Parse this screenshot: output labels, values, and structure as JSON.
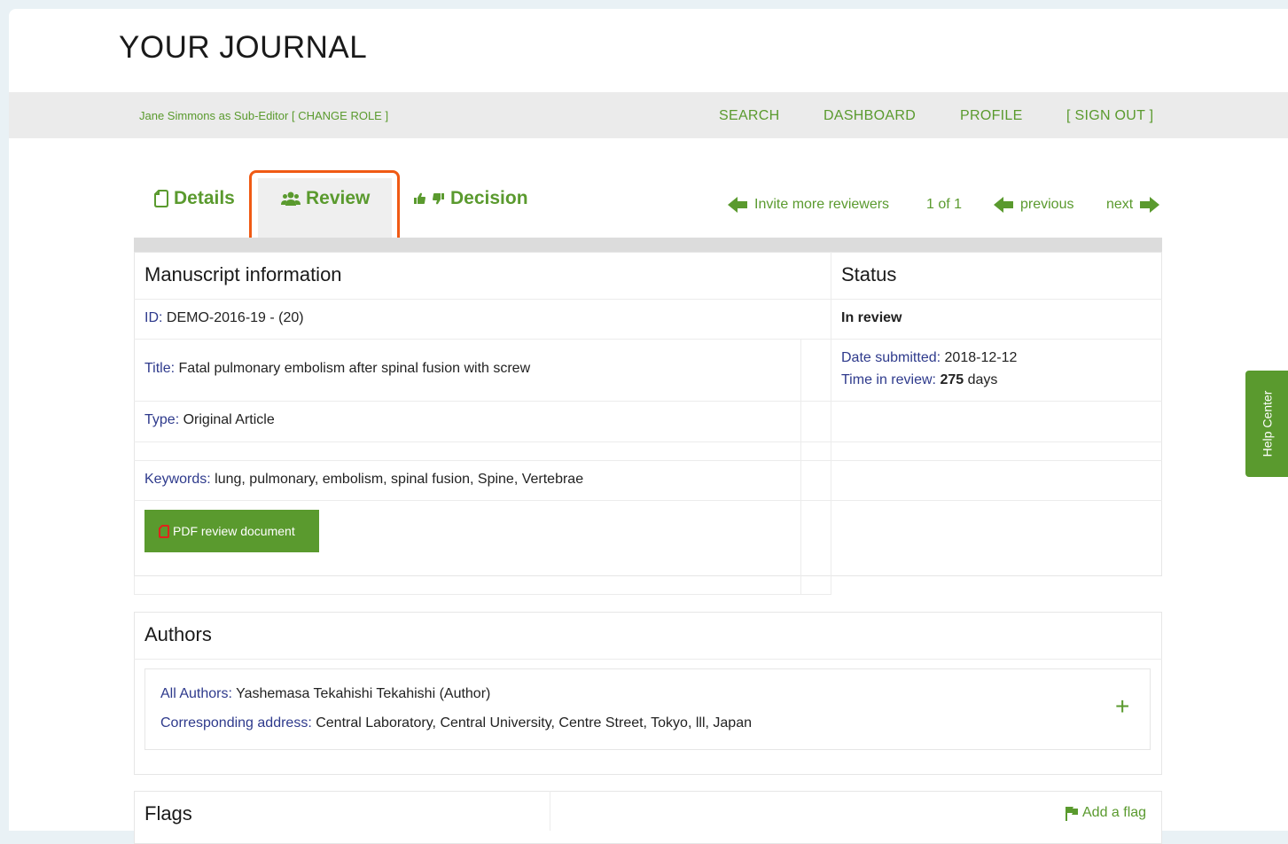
{
  "header": {
    "journal_title": "YOUR JOURNAL"
  },
  "topbar": {
    "user": "Jane Simmons as Sub-Editor",
    "change_role": "[ CHANGE ROLE ]",
    "search": "SEARCH",
    "dashboard": "DASHBOARD",
    "profile": "PROFILE",
    "sign_out": "[ SIGN OUT ]"
  },
  "tabs": {
    "details": "Details",
    "review": "Review",
    "decision": "Decision"
  },
  "pager": {
    "invite": "Invite more reviewers",
    "count": "1 of 1",
    "previous": "previous",
    "next": "next"
  },
  "manuscript": {
    "heading": "Manuscript information",
    "id_label": "ID:",
    "id_value": "DEMO-2016-19 - (20)",
    "title_label": "Title:",
    "title_value": "Fatal pulmonary embolism after spinal fusion with screw",
    "type_label": "Type:",
    "type_value": "Original Article",
    "keywords_label": "Keywords:",
    "keywords_value": "lung, pulmonary, embolism, spinal fusion, Spine, Vertebrae",
    "pdf_button": "PDF review document"
  },
  "status": {
    "heading": "Status",
    "state": "In review",
    "date_label": "Date submitted:",
    "date_value": "2018-12-12",
    "time_label": "Time in review:",
    "time_value": "275",
    "time_unit": "days"
  },
  "authors": {
    "heading": "Authors",
    "all_label": "All Authors:",
    "all_value": "Yashemasa Tekahishi Tekahishi (Author)",
    "address_label": "Corresponding address:",
    "address_value": "Central Laboratory, Central University, Centre Street, Tokyo, lll, Japan",
    "expand": "+"
  },
  "flags": {
    "heading": "Flags",
    "add": "Add a flag"
  },
  "help": {
    "label": "Help Center"
  }
}
